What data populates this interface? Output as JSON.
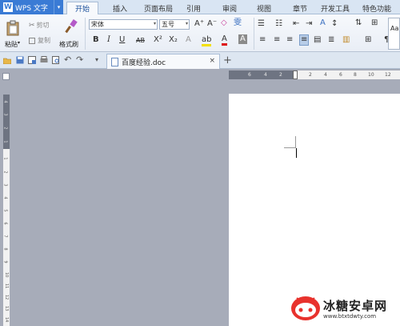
{
  "app": {
    "logo": "W",
    "name": "WPS 文字",
    "arrow": "▾"
  },
  "menu_tabs": [
    {
      "label": "开始",
      "active": true
    },
    {
      "label": "插入"
    },
    {
      "label": "页面布局"
    },
    {
      "label": "引用"
    },
    {
      "label": "审阅"
    },
    {
      "label": "视图"
    },
    {
      "label": "章节"
    },
    {
      "label": "开发工具"
    },
    {
      "label": "特色功能"
    }
  ],
  "clipboard": {
    "paste": "粘贴",
    "cut": "剪切",
    "copy": "复制",
    "format_painter": "格式刷"
  },
  "font": {
    "name": "宋体",
    "size": "五号"
  },
  "format_glyphs": {
    "bold": "B",
    "italic": "I",
    "underline": "U",
    "strike": "AB",
    "superscript": "X²",
    "subscript": "X₂",
    "font_color": "A",
    "grow": "A⁺",
    "shrink": "A⁻",
    "char_shade": "A"
  },
  "styles_preview": "AaB",
  "document_tab": {
    "title": "百度经验.doc",
    "close": "×",
    "new_tab": "+"
  },
  "ruler_h_labels": [
    "6",
    "4",
    "2",
    "2",
    "4",
    "6",
    "8",
    "10",
    "12"
  ],
  "ruler_v_labels": [
    "4",
    "3",
    "2",
    "1",
    "1",
    "2",
    "3",
    "4",
    "5",
    "6",
    "7",
    "8",
    "9",
    "10",
    "11",
    "12",
    "13",
    "14"
  ],
  "watermark": {
    "text": "冰糖安卓网",
    "url": "www.btxtdwty.com"
  },
  "colors": {
    "accent": "#3a7bd5",
    "ribbon_bg": "#e9eef6",
    "page_bg": "#ffffff",
    "workspace": "#a7acb9"
  }
}
